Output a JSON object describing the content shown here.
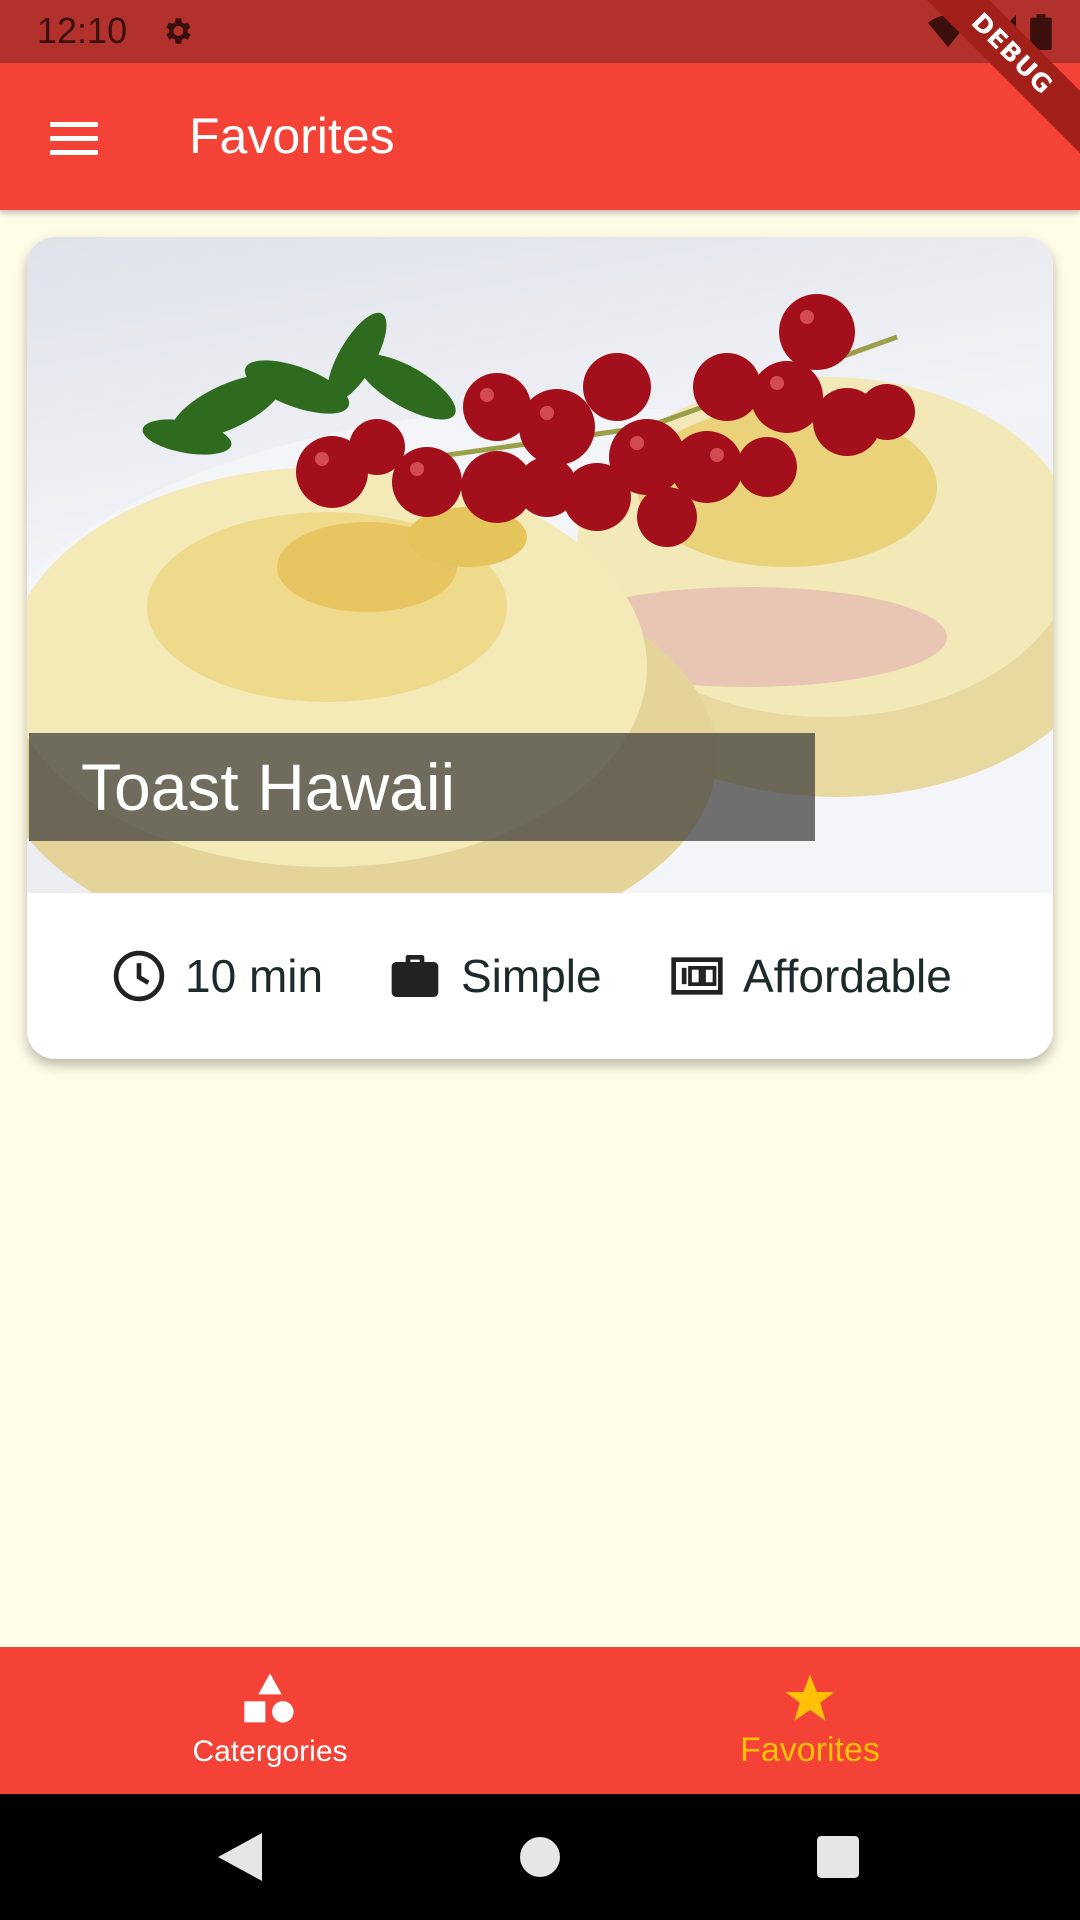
{
  "status_bar": {
    "time": "12:10",
    "icons": [
      "settings-icon",
      "wifi-icon",
      "signal-icon",
      "battery-icon"
    ]
  },
  "debug_banner": {
    "label": "DEBUG"
  },
  "app_bar": {
    "title": "Favorites",
    "menu_icon": "menu-icon",
    "color": "#F44336"
  },
  "meal_card": {
    "title": "Toast Hawaii",
    "duration": "10 min",
    "complexity": "Simple",
    "affordability": "Affordable",
    "icons": [
      "schedule-icon",
      "work-icon",
      "money-icon"
    ]
  },
  "bottom_nav": {
    "items": [
      {
        "label": "Catergories",
        "icon": "category-icon",
        "selected": false
      },
      {
        "label": "Favorites",
        "icon": "star-icon",
        "selected": true
      }
    ],
    "selected_color": "#FFC107",
    "unselected_color": "#FFFFFF"
  },
  "system_nav": {
    "buttons": [
      "back-icon",
      "home-icon",
      "recents-icon"
    ]
  },
  "colors": {
    "background": "#FFFDE7",
    "status_bar": "#B3312C",
    "accent": "#FFC107"
  }
}
